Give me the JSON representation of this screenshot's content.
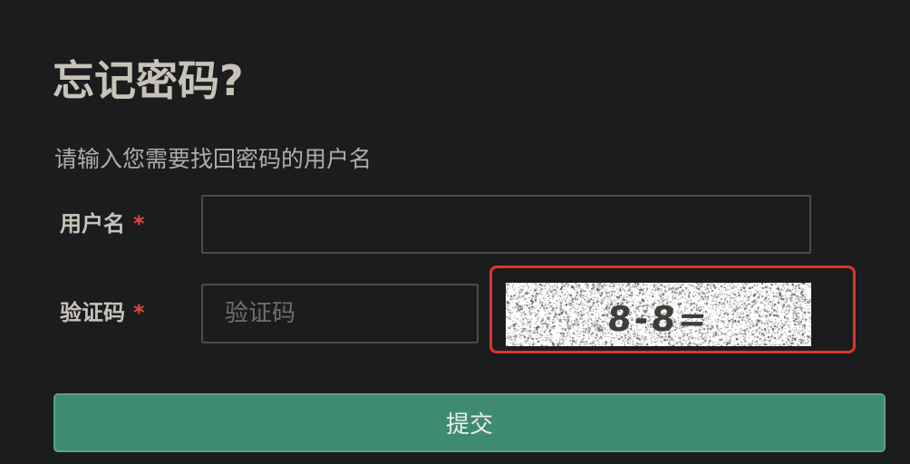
{
  "page": {
    "title": "忘记密码?",
    "subtitle": "请输入您需要找回密码的用户名"
  },
  "form": {
    "username": {
      "label": "用户名",
      "required_mark": "*",
      "value": ""
    },
    "captcha": {
      "label": "验证码",
      "required_mark": "*",
      "value": "",
      "placeholder": "验证码",
      "image_text": "8-8="
    },
    "submit_label": "提交"
  },
  "colors": {
    "background": "#1b1c1e",
    "text": "#c8c3ba",
    "text_muted": "#b1ada6",
    "placeholder": "#6f6e6b",
    "required": "#e2473c",
    "input_border": "#4a4b4e",
    "primary": "#3f8a72",
    "primary_border": "#55a487",
    "button_text": "#eaede9",
    "highlight": "#e0352a"
  }
}
